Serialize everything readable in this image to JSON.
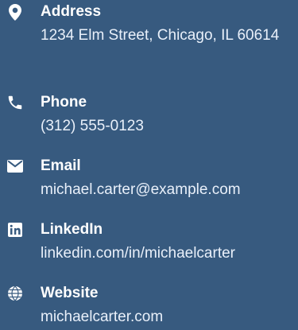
{
  "colors": {
    "background": "#375a7f",
    "text": "#ffffff",
    "value_text": "#e9f0fa"
  },
  "contacts": [
    {
      "label": "Address",
      "value": "1234 Elm Street, Chicago, IL 60614",
      "icon": "map-marker-icon"
    },
    {
      "label": "Phone",
      "value": "(312) 555-0123",
      "icon": "phone-icon"
    },
    {
      "label": "Email",
      "value": "michael.carter@example.com",
      "icon": "envelope-icon"
    },
    {
      "label": "LinkedIn",
      "value": "linkedin.com/in/michaelcarter",
      "icon": "linkedin-icon"
    },
    {
      "label": "Website",
      "value": "michaelcarter.com",
      "icon": "globe-icon"
    }
  ]
}
